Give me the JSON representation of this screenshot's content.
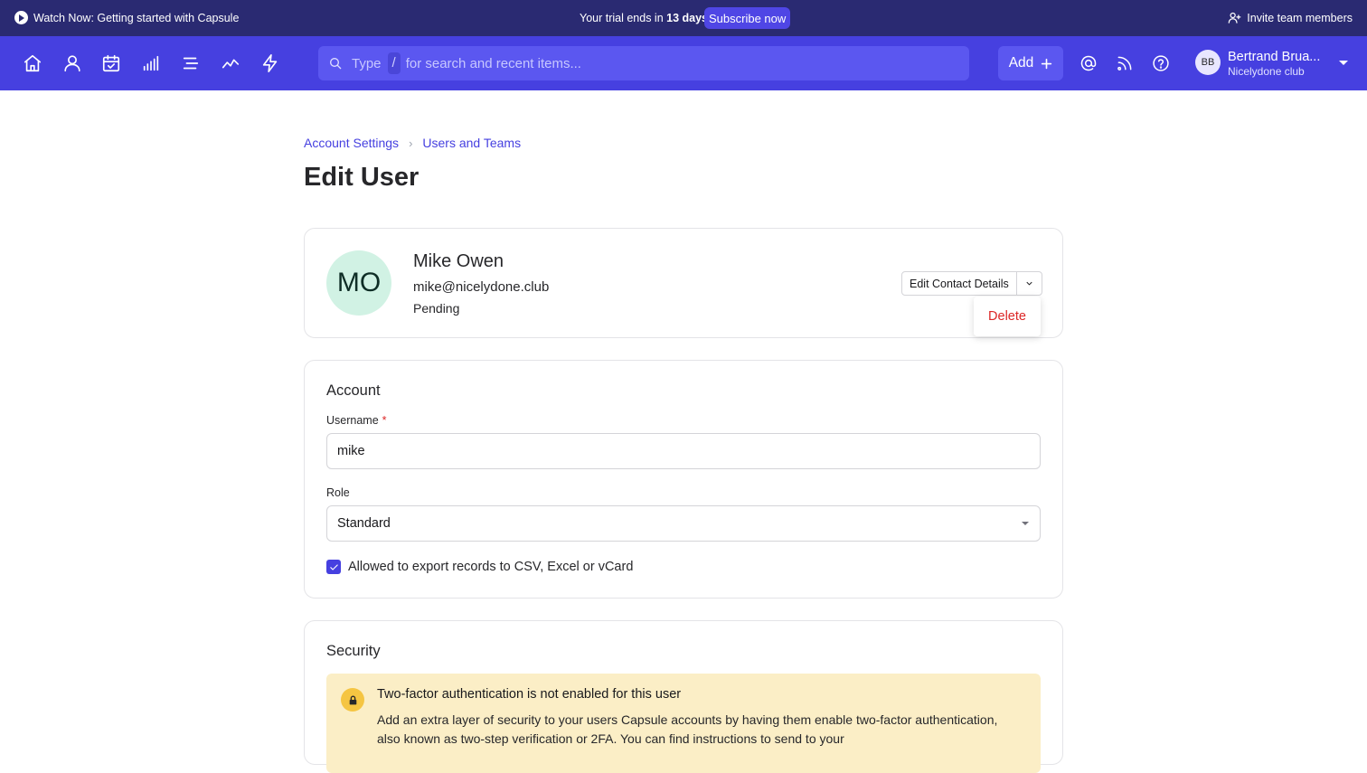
{
  "topbar": {
    "watch_label": "Watch Now: Getting started with Capsule",
    "trial_prefix": "Your trial ends in",
    "trial_days": "13 days",
    "subscribe_label": "Subscribe now",
    "invite_label": "Invite team members"
  },
  "nav": {
    "icons": [
      "home-icon",
      "person-icon",
      "calendar-check-icon",
      "bar-chart-icon",
      "list-icon",
      "trend-icon",
      "bolt-icon"
    ],
    "search_type": "Type",
    "search_slash": "/",
    "search_rest": "for search and recent items...",
    "add_label": "Add",
    "right_icons": [
      "mention-icon",
      "feed-icon",
      "help-icon"
    ],
    "user_initials": "BB",
    "user_name": "Bertrand Brua...",
    "user_org": "Nicelydone club"
  },
  "breadcrumb": {
    "items": [
      "Account Settings",
      "Users and Teams"
    ],
    "separator": "›"
  },
  "page_title": "Edit User",
  "profile": {
    "initials": "MO",
    "name": "Mike Owen",
    "email": "mike@nicelydone.club",
    "status": "Pending",
    "edit_label": "Edit Contact Details",
    "dropdown_item": "Delete"
  },
  "account": {
    "title": "Account",
    "username_label": "Username",
    "required_mark": "*",
    "username_value": "mike",
    "role_label": "Role",
    "role_value": "Standard",
    "export_label": "Allowed to export records to CSV, Excel or vCard",
    "export_checked": true
  },
  "security": {
    "title": "Security",
    "alert_title": "Two-factor authentication is not enabled for this user",
    "alert_body": "Add an extra layer of security to your users Capsule accounts by having them enable two-factor authentication, also known as two-step verification or 2FA. You can find instructions to send to your"
  },
  "colors": {
    "topbar": "#2a2a72",
    "navbar": "#4640e0",
    "accent": "#4f46e5",
    "danger": "#dc2626",
    "avatar_bg": "#d1f2e4",
    "alert_bg": "#fbeec6"
  }
}
